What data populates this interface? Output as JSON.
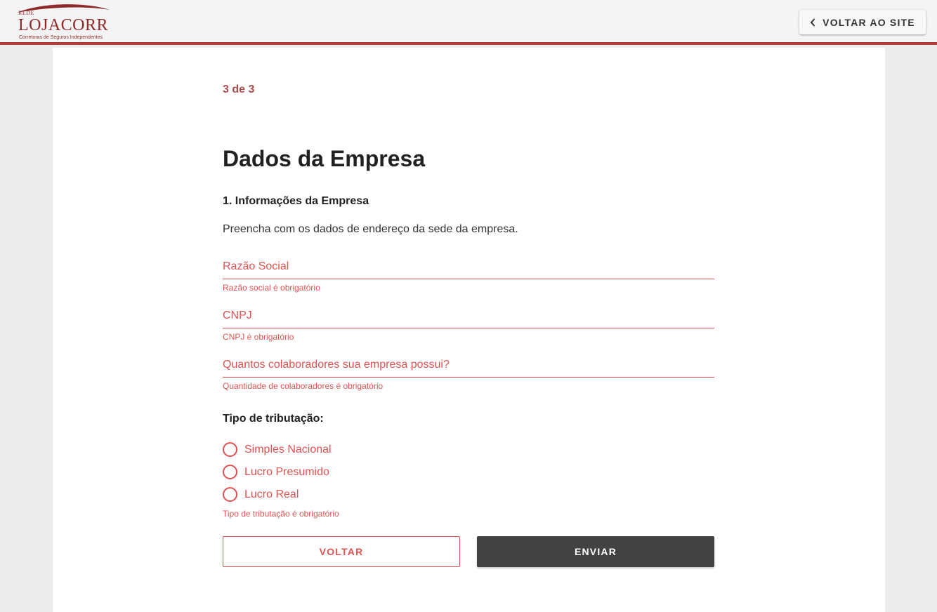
{
  "header": {
    "logo": {
      "top_text": "REDE",
      "main_text": "LOJACORR",
      "sub_text": "Corretoras de Seguros Independentes"
    },
    "back_button": {
      "label": "VOLTAR AO SITE",
      "icon": "chevron-left-icon"
    }
  },
  "form": {
    "step": "3 de 3",
    "title": "Dados da Empresa",
    "section_title": "1. Informações da Empresa",
    "description": "Preencha com os dados de endereço da sede da empresa.",
    "fields": [
      {
        "placeholder": "Razão Social",
        "value": "",
        "error": "Razão social é obrigatório"
      },
      {
        "placeholder": "CNPJ",
        "value": "",
        "error": "CNPJ é obrigatório"
      },
      {
        "placeholder": "Quantos colaboradores sua empresa possui?",
        "value": "",
        "error": "Quantidade de colaboradores é obrigatório"
      }
    ],
    "tax": {
      "label": "Tipo de tributação:",
      "options": [
        "Simples Nacional",
        "Lucro Presumido",
        "Lucro Real"
      ],
      "error": "Tipo de tributação é obrigatório"
    },
    "buttons": {
      "back": "VOLTAR",
      "submit": "ENVIAR"
    }
  },
  "colors": {
    "accent": "#b23b3b",
    "error": "#e05252",
    "step": "#a94f4f",
    "submit_bg": "#424242"
  }
}
